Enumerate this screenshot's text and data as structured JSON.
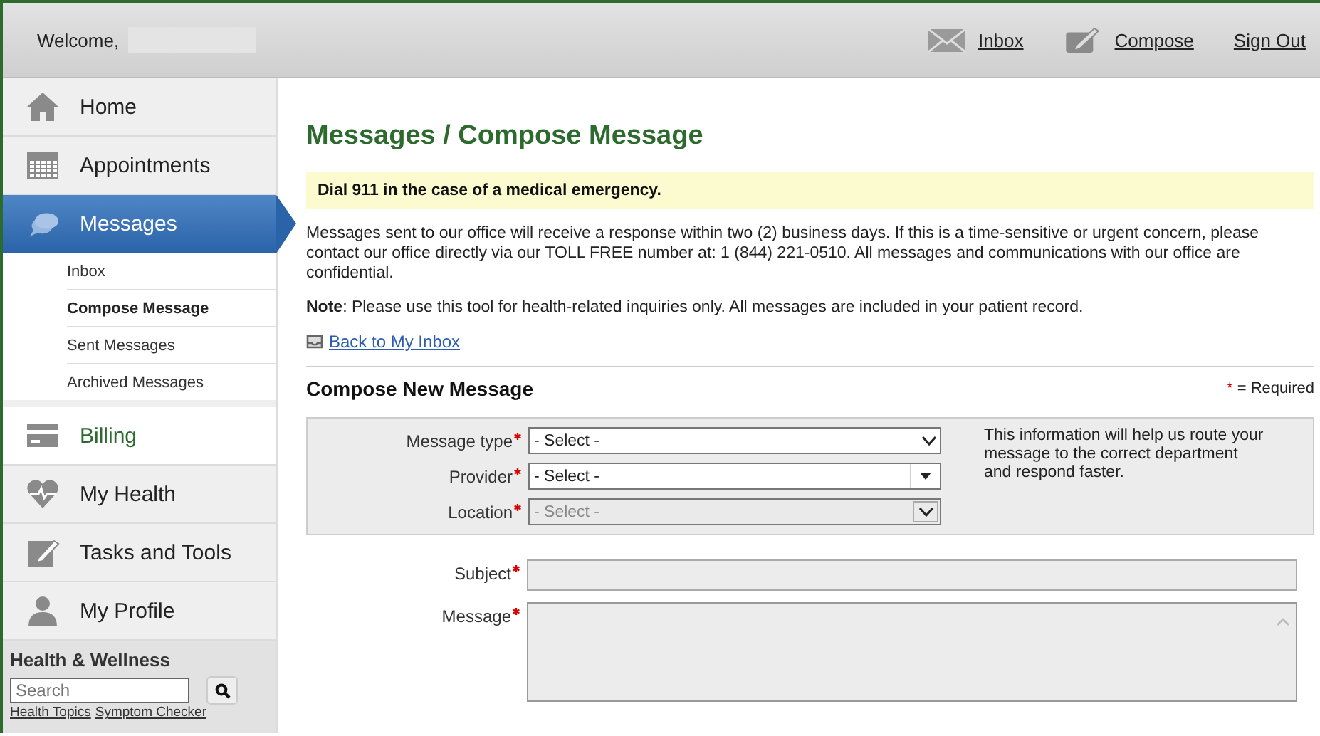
{
  "header": {
    "welcome": "Welcome,",
    "links": [
      {
        "kind": "inbox",
        "label": "Inbox"
      },
      {
        "kind": "compose",
        "label": "Compose"
      },
      {
        "kind": "signout",
        "label": "Sign Out"
      }
    ]
  },
  "sidebar": {
    "items": [
      {
        "kind": "home",
        "label": "Home",
        "selected": false,
        "highlighted": false
      },
      {
        "kind": "appointments",
        "label": "Appointments",
        "selected": false,
        "highlighted": false
      },
      {
        "kind": "messages",
        "label": "Messages",
        "selected": true,
        "highlighted": false,
        "children": [
          {
            "label": "Inbox",
            "selected": false
          },
          {
            "label": "Compose Message",
            "selected": true
          },
          {
            "label": "Sent Messages",
            "selected": false
          },
          {
            "label": "Archived Messages",
            "selected": false
          }
        ]
      },
      {
        "kind": "billing",
        "label": "Billing",
        "selected": false,
        "highlighted": true
      },
      {
        "kind": "health",
        "label": "My Health",
        "selected": false,
        "highlighted": false
      },
      {
        "kind": "tasks",
        "label": "Tasks and Tools",
        "selected": false,
        "highlighted": false
      },
      {
        "kind": "profile",
        "label": "My Profile",
        "selected": false,
        "highlighted": false
      }
    ],
    "wellness": {
      "title": "Health & Wellness",
      "search_placeholder": "Search",
      "links": [
        "Health Topics",
        "Symptom Checker"
      ]
    }
  },
  "page": {
    "title": "Messages / Compose Message",
    "alert": "Dial 911 in the case of a medical emergency.",
    "intro": "Messages sent to our office will receive a response within two (2) business days. If this is a time-sensitive or urgent concern, please contact our office directly via our TOLL FREE number at: 1 (844) 221-0510. All messages and communications with our office are confidential.",
    "note": "**Note**: Please use this tool for health-related inquiries only. All messages are included in your patient record.",
    "back_link": "Back to My Inbox",
    "section_title": "Compose New Message",
    "required_mark": "*",
    "required_legend": "= Required",
    "routing_fields": [
      {
        "kind": "select",
        "label": "Message type",
        "required": true,
        "value": "- Select -",
        "disabled": false
      },
      {
        "kind": "combo",
        "label": "Provider",
        "required": true,
        "value": "- Select -",
        "disabled": false
      },
      {
        "kind": "select",
        "label": "Location",
        "required": true,
        "value": "- Select -",
        "disabled": true
      }
    ],
    "routing_help": "This information will help us route your message to the correct department and respond faster.",
    "fields": [
      {
        "kind": "text",
        "label": "Subject",
        "required": true
      },
      {
        "kind": "textarea",
        "label": "Message",
        "required": true
      }
    ]
  }
}
